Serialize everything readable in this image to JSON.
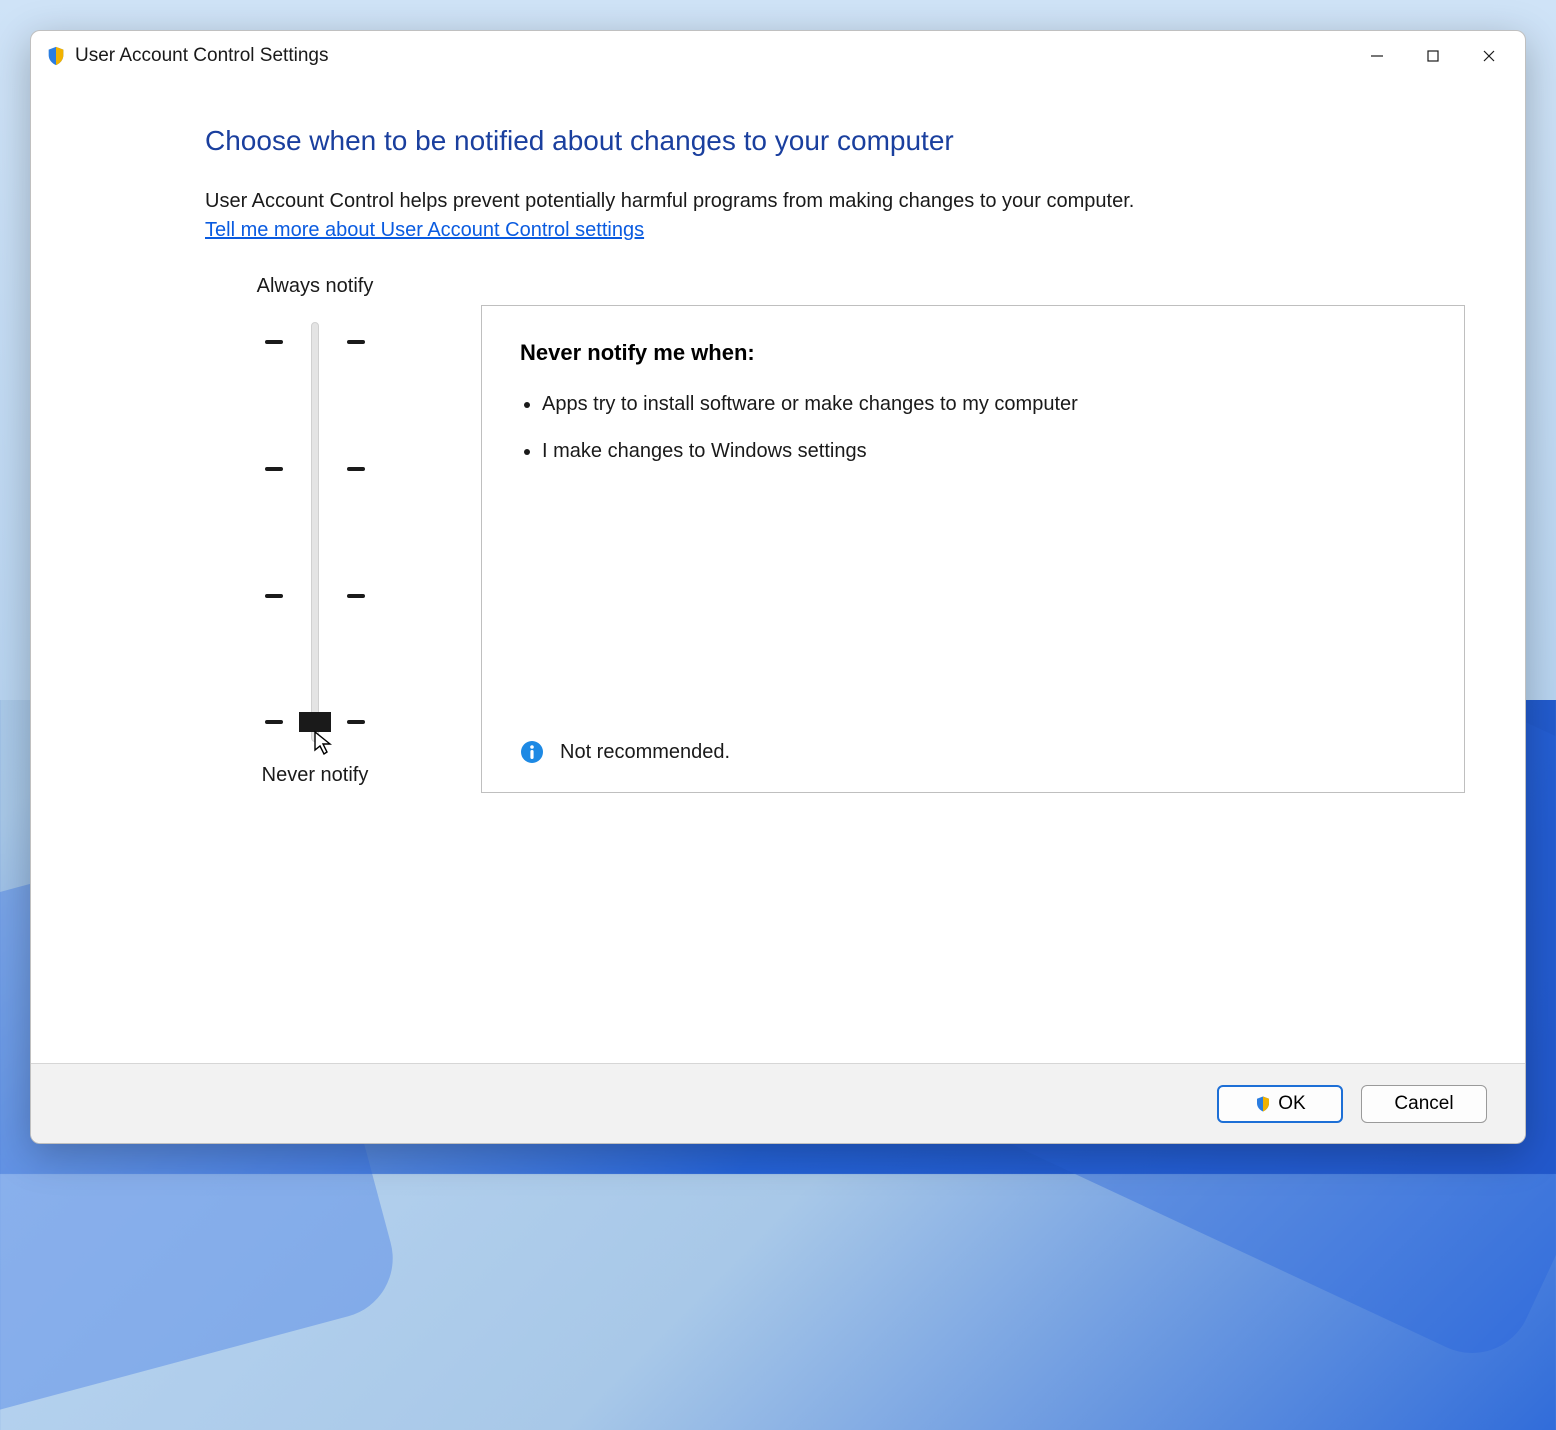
{
  "window": {
    "title": "User Account Control Settings"
  },
  "content": {
    "heading": "Choose when to be notified about changes to your computer",
    "description": "User Account Control helps prevent potentially harmful programs from making changes to your computer.",
    "help_link": "Tell me more about User Account Control settings"
  },
  "slider": {
    "top_label": "Always notify",
    "bottom_label": "Never notify",
    "levels": 4,
    "selected_level_index": 3
  },
  "detail": {
    "heading": "Never notify me when:",
    "bullets": [
      "Apps try to install software or make changes to my computer",
      "I make changes to Windows settings"
    ],
    "status_text": "Not recommended."
  },
  "buttons": {
    "ok": "OK",
    "cancel": "Cancel"
  }
}
